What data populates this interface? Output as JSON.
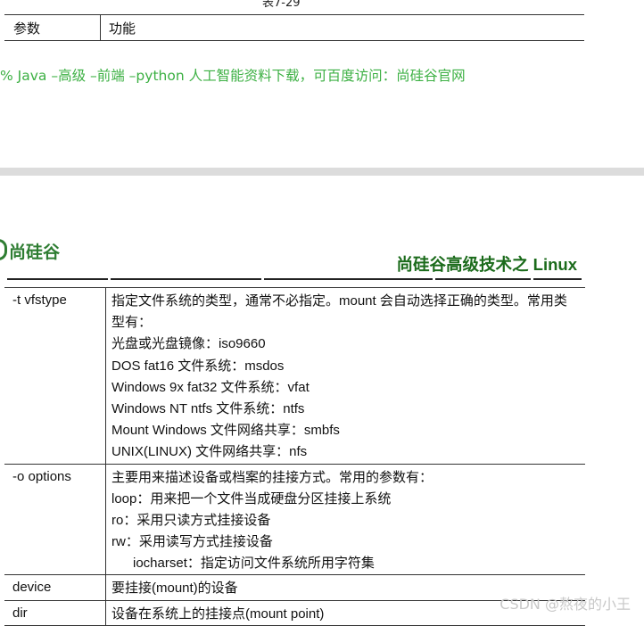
{
  "caption": "表7-29",
  "top_table": {
    "col1": "参数",
    "col2": "功能"
  },
  "ad_text": "% Java –高级 –前端 –python 人工智能资料下载，可百度访问：尚硅谷官网",
  "logo_text": "尚硅谷",
  "header_title": "尚硅谷高级技术之 Linux",
  "rows": [
    {
      "param": "-t vfstype",
      "lines": [
        "指定文件系统的类型，通常不必指定。mount 会自动选择正确的类型。常用类型有：",
        "光盘或光盘镜像：iso9660",
        "DOS fat16 文件系统：msdos",
        "Windows 9x fat32 文件系统：vfat",
        "Windows NT ntfs 文件系统：ntfs",
        "Mount Windows 文件网络共享：smbfs",
        "UNIX(LINUX) 文件网络共享：nfs"
      ]
    },
    {
      "param": "-o options",
      "lines": [
        "主要用来描述设备或档案的挂接方式。常用的参数有：",
        "loop：用来把一个文件当成硬盘分区挂接上系统",
        "ro：采用只读方式挂接设备",
        "rw：采用读写方式挂接设备",
        "iocharset：指定访问文件系统所用字符集"
      ]
    },
    {
      "param": "device",
      "lines": [
        "要挂接(mount)的设备"
      ]
    },
    {
      "param": "dir",
      "lines": [
        "设备在系统上的挂接点(mount point)"
      ]
    }
  ],
  "watermark": "CSDN @熬夜的小王"
}
